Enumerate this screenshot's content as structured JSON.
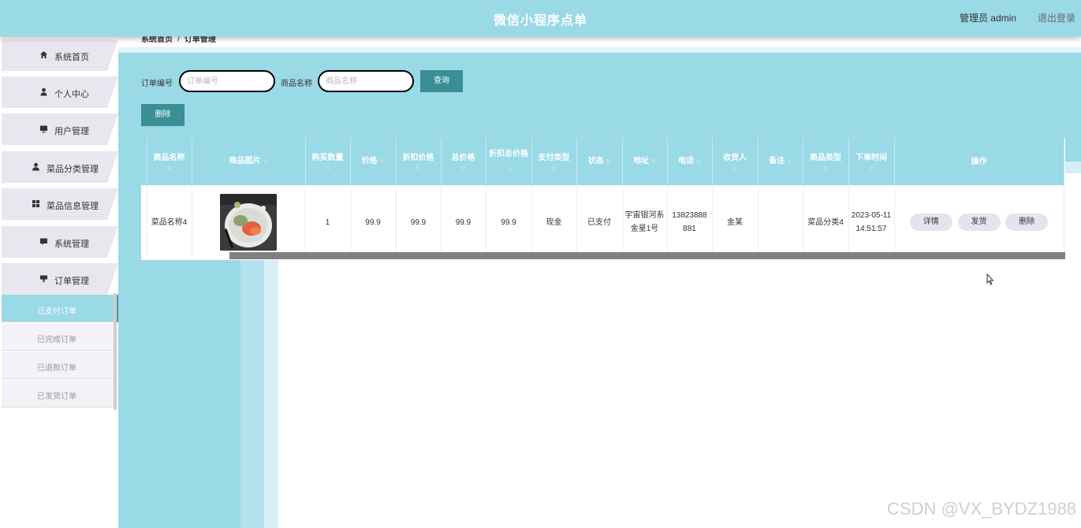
{
  "header": {
    "title": "微信小程序点单",
    "user": "管理员 admin",
    "logout": "退出登录"
  },
  "breadcrumb": {
    "home": "系统首页",
    "current": "订单管理",
    "sep": "/"
  },
  "sidebar": {
    "items": [
      {
        "label": "系统首页",
        "icon": "home-icon"
      },
      {
        "label": "个人中心",
        "icon": "user-icon"
      },
      {
        "label": "用户管理",
        "icon": "monitor-icon"
      },
      {
        "label": "菜品分类管理",
        "icon": "person-icon"
      },
      {
        "label": "菜品信息管理",
        "icon": "grid-icon"
      },
      {
        "label": "系统管理",
        "icon": "chat-icon"
      },
      {
        "label": "订单管理",
        "icon": "order-icon"
      }
    ],
    "subitems": [
      {
        "label": "已支付订单",
        "active": true
      },
      {
        "label": "已完成订单",
        "active": false
      },
      {
        "label": "已退款订单",
        "active": false
      },
      {
        "label": "已发货订单",
        "active": false
      }
    ]
  },
  "search": {
    "order_no_label": "订单编号",
    "order_no_placeholder": "订单编号",
    "product_name_label": "商品名称",
    "product_name_placeholder": "商品名称",
    "query_button": "查询",
    "delete_button": "删除"
  },
  "table": {
    "columns": [
      "商品名称",
      "商品图片",
      "购买数量",
      "价格",
      "折扣价格",
      "总价格",
      "折扣总价格",
      "支付类型",
      "状态",
      "地址",
      "电话",
      "收货人",
      "备注",
      "商品类型",
      "下单时间",
      "操作"
    ],
    "rows": [
      {
        "name": "菜品名称4",
        "qty": "1",
        "price": "99.9",
        "discount_price": "99.9",
        "total": "99.9",
        "discount_total": "99.9",
        "pay_type": "现金",
        "status": "已支付",
        "address": "宇宙银河系金星1号",
        "phone": "13823888881",
        "receiver": "金某",
        "note": "",
        "category": "菜品分类4",
        "time": "2023-05-11 14:51:57",
        "actions": [
          "详情",
          "发货",
          "删除"
        ]
      }
    ]
  },
  "watermark": "CSDN @VX_BYDZ1988",
  "colors": {
    "primary": "#9ad9e6",
    "button": "#3a8e96",
    "menu_bg": "#e8e6ef"
  }
}
